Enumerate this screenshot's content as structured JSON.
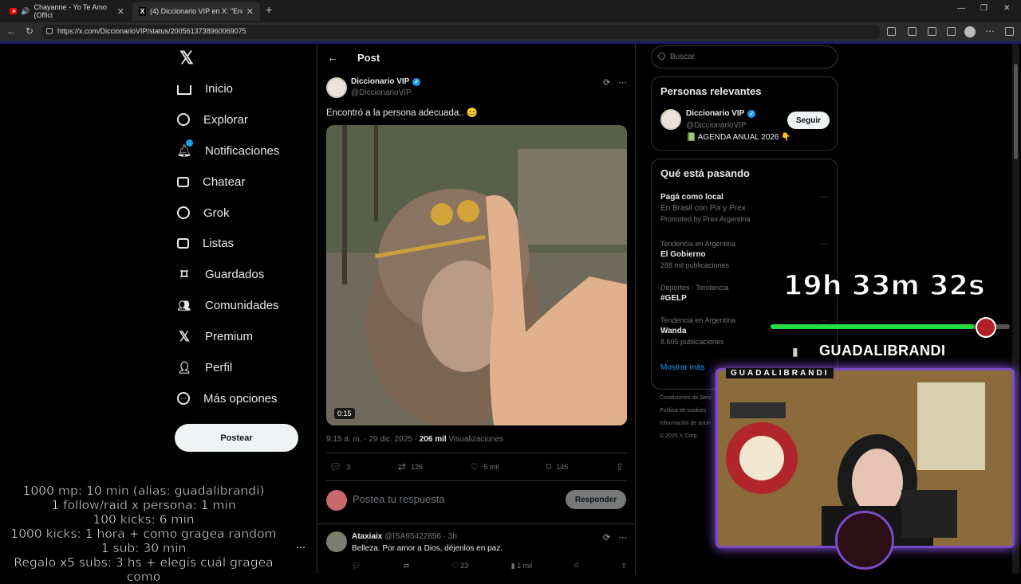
{
  "browser": {
    "tabs": [
      {
        "title": "Chayanne - Yo Te Amo (Offici"
      },
      {
        "title": "(4) Diccionario VIP en X: \"Encontró"
      }
    ],
    "url": "https://x.com/DiccionarioVIP/status/2005613738960069075"
  },
  "nav": {
    "items": [
      {
        "label": "Inicio",
        "icon": "home-icon"
      },
      {
        "label": "Explorar",
        "icon": "search-icon"
      },
      {
        "label": "Notificaciones",
        "icon": "bell-icon",
        "badge": "4"
      },
      {
        "label": "Chatear",
        "icon": "mail-icon"
      },
      {
        "label": "Grok",
        "icon": "grok-icon"
      },
      {
        "label": "Listas",
        "icon": "list-icon"
      },
      {
        "label": "Guardados",
        "icon": "bookmark-icon"
      },
      {
        "label": "Comunidades",
        "icon": "people-icon"
      },
      {
        "label": "Premium",
        "icon": "x-icon"
      },
      {
        "label": "Perfil",
        "icon": "person-icon"
      },
      {
        "label": "Más opciones",
        "icon": "more-icon"
      }
    ],
    "post_button": "Postear"
  },
  "post": {
    "header": "Post",
    "author_name": "Diccionario VIP",
    "author_handle": "@DiccionarioVIP",
    "text": "Encontró a la persona adecuada.. 😊",
    "video_duration": "0:15",
    "timestamp": "9:15 a. m. · 29 dic. 2025 · ",
    "views_count": "206 mil",
    "views_label": " Visualizaciones",
    "replies": "3",
    "reposts": "126",
    "likes": "5 mil",
    "bookmarks": "145",
    "reply_placeholder": "Postea tu respuesta",
    "reply_button": "Responder"
  },
  "comment": {
    "name": "Ataxiaix",
    "meta": "@ISA95422856 · 3h",
    "text": "Belleza. Por amor a Dios, déjenlos en paz.",
    "likes": "23",
    "views": "1 mil"
  },
  "sidebar": {
    "search_placeholder": "Buscar",
    "relevant_title": "Personas relevantes",
    "relevant": {
      "name": "Diccionario VIP",
      "handle": "@DiccionarioVIP",
      "bio": "📗 AGENDA ANUAL 2026 👇",
      "follow": "Seguir"
    },
    "trending_title": "Qué está pasando",
    "trends": [
      {
        "name": "Pagá como local",
        "sub": "En Brasil con Pix y Prex",
        "cat": "Promoted by Prex Argentina"
      },
      {
        "cat": "Tendencia en Argentina",
        "name": "El Gobierno",
        "sub": "288 mil publicaciones"
      },
      {
        "cat": "Deportes · Tendencia",
        "name": "#GELP",
        "sub": ""
      },
      {
        "cat": "Tendencia en Argentina",
        "name": "Wanda",
        "sub": "8.605 publicaciones"
      }
    ],
    "show_more": "Mostrar más",
    "footer": [
      "Condiciones de Serv",
      "Política de cookies",
      "Información de anun",
      "© 2025 X Corp."
    ]
  },
  "stream": {
    "timer": "19h 33m 32s",
    "progress": 0.85,
    "streamer": "GUADALIBRANDI",
    "cam_label": "GUADALIBRANDI",
    "goals": [
      "1000 mp: 10 min (alias: guadalibrandi)",
      "1 follow/raid x persona: 1 min",
      "100 kicks: 6 min",
      "1000 kicks: 1 hora + como gragea random",
      "1 sub: 30 min",
      "Regalo x5 subs: 3 hs + elegís cuál gragea como"
    ]
  },
  "colors": {
    "accent": "#1d9bf0",
    "progress": "#22e040",
    "cam_border": "#7a4bc8"
  }
}
